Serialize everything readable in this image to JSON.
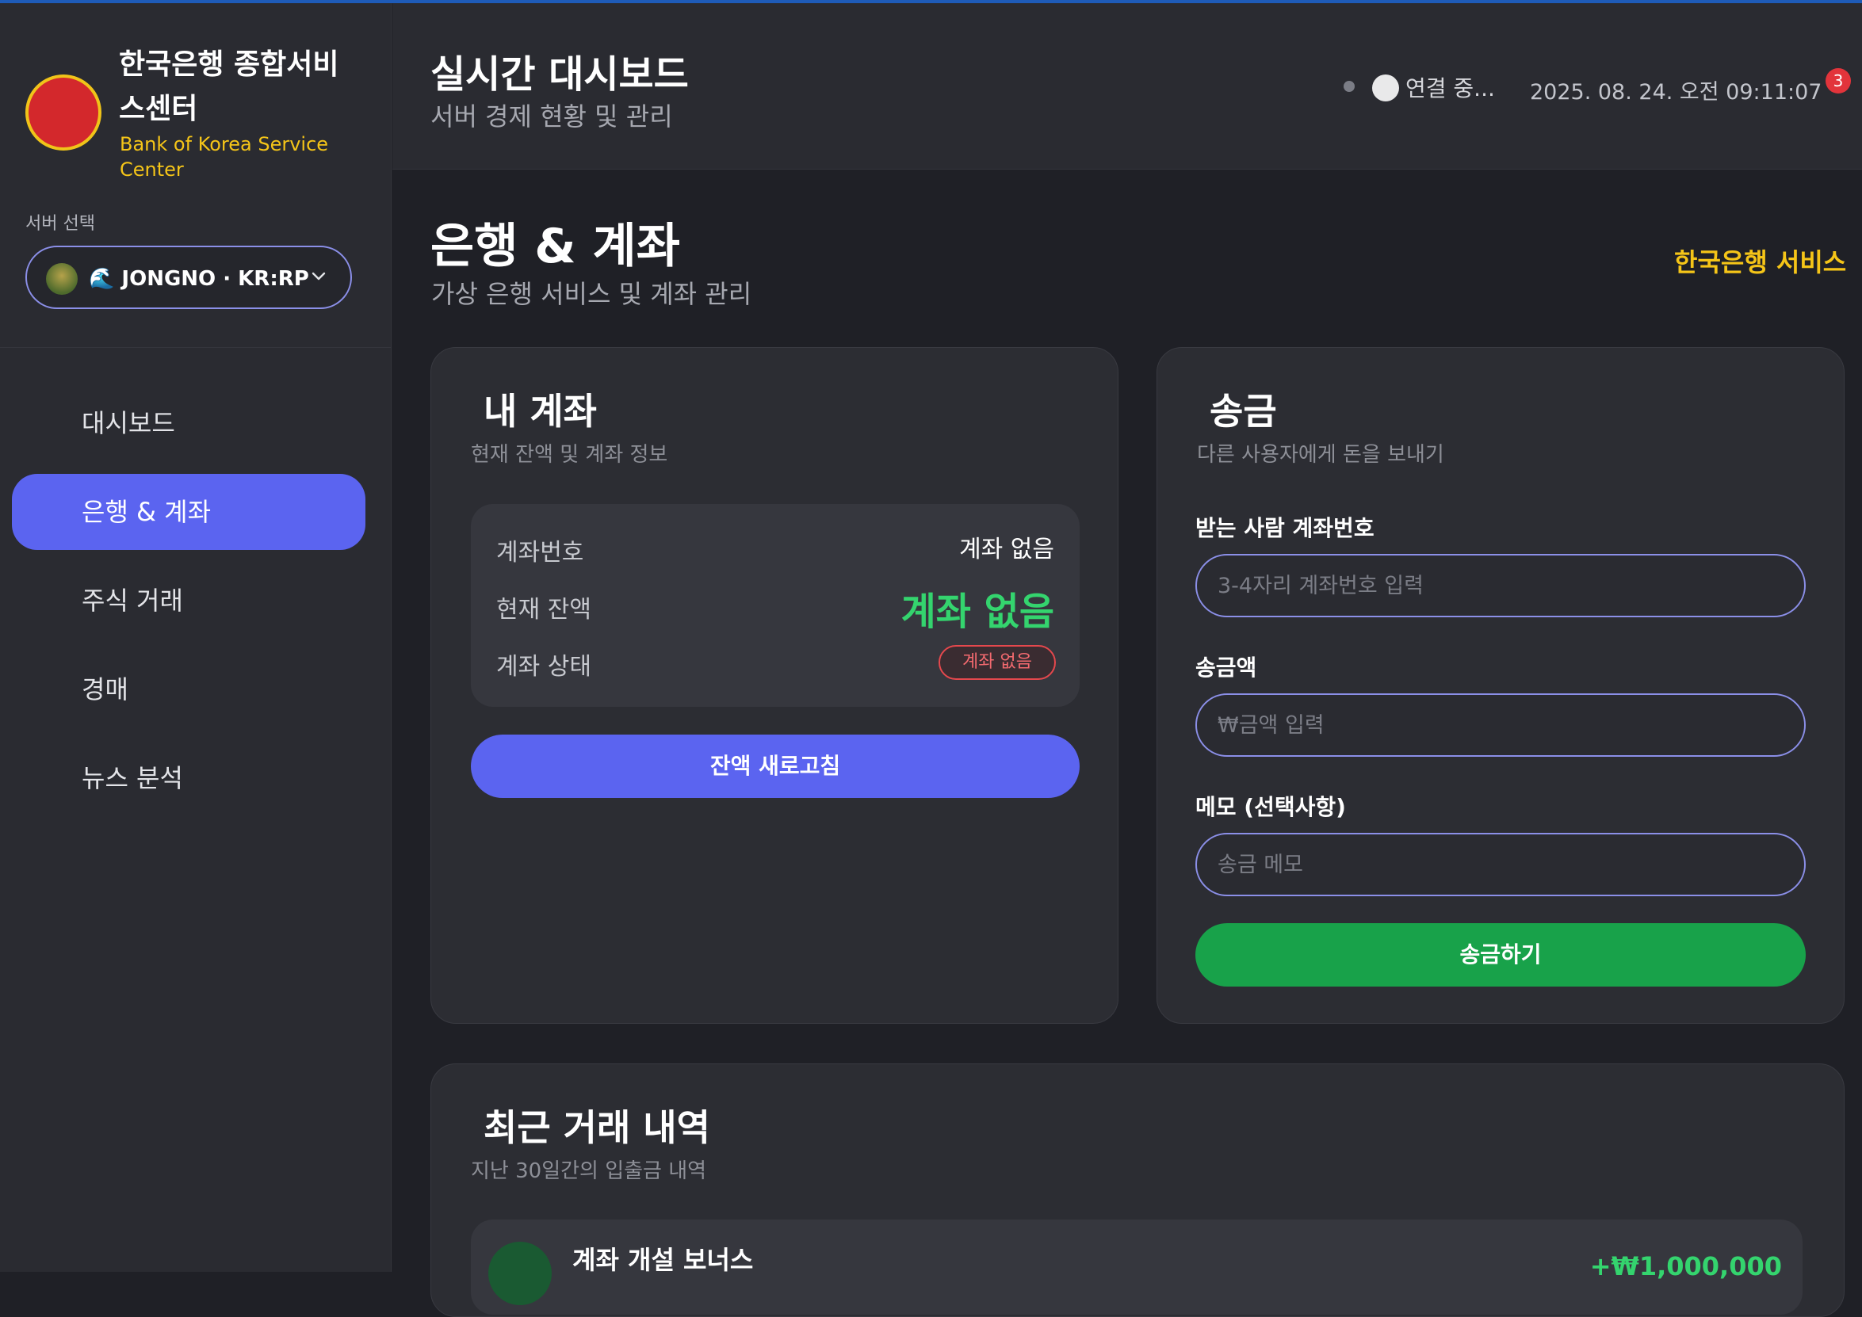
{
  "brand": {
    "name": "한국은행 종합서비스센터",
    "subtitle": "Bank of Korea Service Center"
  },
  "server": {
    "label": "서버 선택",
    "selected": "🌊 JONGNO · KR:RP"
  },
  "nav": {
    "items": [
      {
        "label": "대시보드",
        "active": false
      },
      {
        "label": "은행 & 계좌",
        "active": true
      },
      {
        "label": "주식 거래",
        "active": false
      },
      {
        "label": "경매",
        "active": false
      },
      {
        "label": "뉴스 분석",
        "active": false
      }
    ]
  },
  "header": {
    "title": "실시간 대시보드",
    "subtitle": "서버 경제 현황 및 관리",
    "connection": "연결 중...",
    "datetime": "2025. 08. 24. 오전 09:11:07",
    "notifications": "3"
  },
  "page": {
    "title": "은행 & 계좌",
    "subtitle": "가상 은행 서비스 및 계좌 관리",
    "service_link": "한국은행 서비스"
  },
  "account": {
    "title": "내 계좌",
    "subtitle": "현재 잔액 및 계좌 정보",
    "number_label": "계좌번호",
    "number_value": "계좌 없음",
    "balance_label": "현재 잔액",
    "balance_value": "계좌 없음",
    "status_label": "계좌 상태",
    "status_value": "계좌 없음",
    "refresh_label": "잔액 새로고침"
  },
  "transfer": {
    "title": "송금",
    "subtitle": "다른 사용자에게 돈을 보내기",
    "recipient_label": "받는 사람 계좌번호",
    "recipient_placeholder": "3-4자리 계좌번호 입력",
    "amount_label": "송금액",
    "amount_placeholder": "₩금액 입력",
    "memo_label": "메모 (선택사항)",
    "memo_placeholder": "송금 메모",
    "send_label": "송금하기"
  },
  "history": {
    "title": "최근 거래 내역",
    "subtitle": "지난 30일간의 입출금 내역",
    "items": [
      {
        "title": "계좌 개설 보너스",
        "amount": "+₩1,000,000"
      }
    ]
  },
  "colors": {
    "accent": "#5b64f0",
    "brand_yellow": "#f5c518",
    "success": "#34d46e",
    "danger": "#e5484d",
    "send_button": "#18a24a"
  }
}
